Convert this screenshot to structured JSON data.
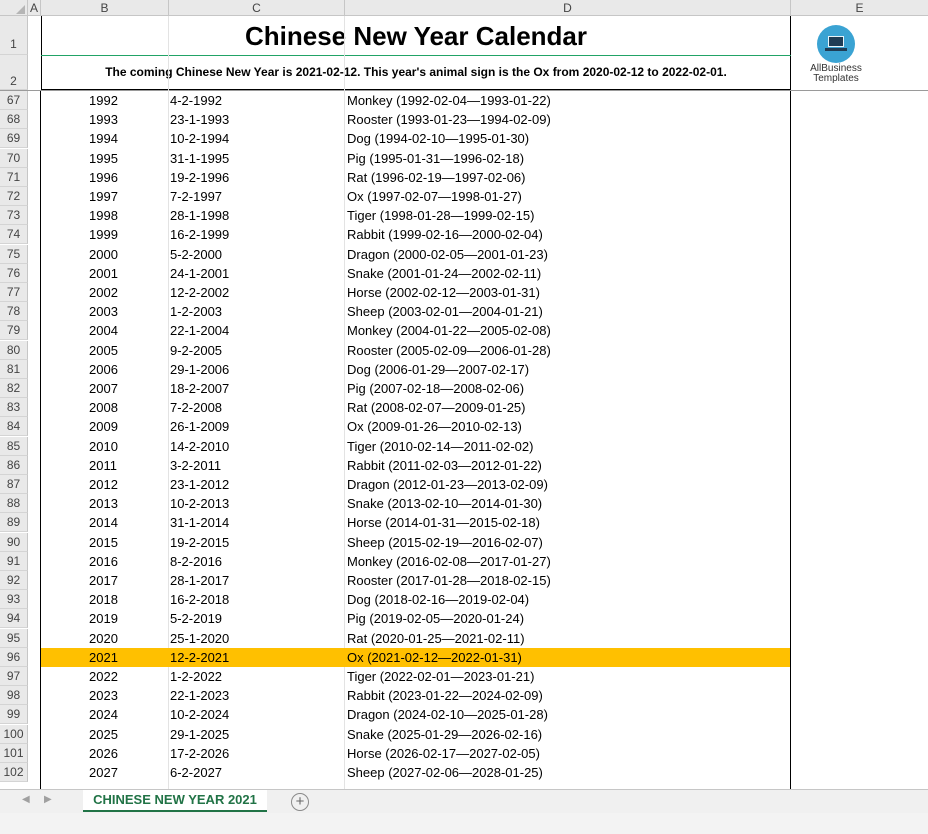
{
  "columns": [
    "A",
    "B",
    "C",
    "D",
    "E"
  ],
  "title": "Chinese New Year Calendar",
  "subtitle": "The coming Chinese New Year is 2021-02-12. This year's animal sign is the Ox from 2020-02-12 to 2022-02-01.",
  "logo": {
    "line1": "AllBusiness",
    "line2": "Templates",
    "icon": "laptop-icon",
    "color": "#3aa3d3"
  },
  "header_rows": [
    "1",
    "2"
  ],
  "highlight_color": "#ffc000",
  "rows": [
    {
      "row": "67",
      "year": "1992",
      "date": "4-2-1992",
      "animal": "Monkey (1992-02-04—1993-01-22)"
    },
    {
      "row": "68",
      "year": "1993",
      "date": "23-1-1993",
      "animal": "Rooster (1993-01-23—1994-02-09)"
    },
    {
      "row": "69",
      "year": "1994",
      "date": "10-2-1994",
      "animal": "Dog (1994-02-10—1995-01-30)"
    },
    {
      "row": "70",
      "year": "1995",
      "date": "31-1-1995",
      "animal": "Pig (1995-01-31—1996-02-18)"
    },
    {
      "row": "71",
      "year": "1996",
      "date": "19-2-1996",
      "animal": "Rat (1996-02-19—1997-02-06)"
    },
    {
      "row": "72",
      "year": "1997",
      "date": "7-2-1997",
      "animal": "Ox (1997-02-07—1998-01-27)"
    },
    {
      "row": "73",
      "year": "1998",
      "date": "28-1-1998",
      "animal": "Tiger (1998-01-28—1999-02-15)"
    },
    {
      "row": "74",
      "year": "1999",
      "date": "16-2-1999",
      "animal": "Rabbit (1999-02-16—2000-02-04)"
    },
    {
      "row": "75",
      "year": "2000",
      "date": "5-2-2000",
      "animal": "Dragon (2000-02-05—2001-01-23)"
    },
    {
      "row": "76",
      "year": "2001",
      "date": "24-1-2001",
      "animal": "Snake (2001-01-24—2002-02-11)"
    },
    {
      "row": "77",
      "year": "2002",
      "date": "12-2-2002",
      "animal": "Horse (2002-02-12—2003-01-31)"
    },
    {
      "row": "78",
      "year": "2003",
      "date": "1-2-2003",
      "animal": "Sheep (2003-02-01—2004-01-21)"
    },
    {
      "row": "79",
      "year": "2004",
      "date": "22-1-2004",
      "animal": "Monkey (2004-01-22—2005-02-08)"
    },
    {
      "row": "80",
      "year": "2005",
      "date": "9-2-2005",
      "animal": "Rooster (2005-02-09—2006-01-28)"
    },
    {
      "row": "81",
      "year": "2006",
      "date": "29-1-2006",
      "animal": "Dog (2006-01-29—2007-02-17)"
    },
    {
      "row": "82",
      "year": "2007",
      "date": "18-2-2007",
      "animal": "Pig (2007-02-18—2008-02-06)"
    },
    {
      "row": "83",
      "year": "2008",
      "date": "7-2-2008",
      "animal": "Rat (2008-02-07—2009-01-25)"
    },
    {
      "row": "84",
      "year": "2009",
      "date": "26-1-2009",
      "animal": "Ox (2009-01-26—2010-02-13)"
    },
    {
      "row": "85",
      "year": "2010",
      "date": "14-2-2010",
      "animal": "Tiger (2010-02-14—2011-02-02)"
    },
    {
      "row": "86",
      "year": "2011",
      "date": "3-2-2011",
      "animal": "Rabbit (2011-02-03—2012-01-22)"
    },
    {
      "row": "87",
      "year": "2012",
      "date": "23-1-2012",
      "animal": "Dragon (2012-01-23—2013-02-09)"
    },
    {
      "row": "88",
      "year": "2013",
      "date": "10-2-2013",
      "animal": "Snake (2013-02-10—2014-01-30)"
    },
    {
      "row": "89",
      "year": "2014",
      "date": "31-1-2014",
      "animal": "Horse (2014-01-31—2015-02-18)"
    },
    {
      "row": "90",
      "year": "2015",
      "date": "19-2-2015",
      "animal": "Sheep (2015-02-19—2016-02-07)"
    },
    {
      "row": "91",
      "year": "2016",
      "date": "8-2-2016",
      "animal": "Monkey (2016-02-08—2017-01-27)"
    },
    {
      "row": "92",
      "year": "2017",
      "date": "28-1-2017",
      "animal": "Rooster (2017-01-28—2018-02-15)"
    },
    {
      "row": "93",
      "year": "2018",
      "date": "16-2-2018",
      "animal": "Dog (2018-02-16—2019-02-04)"
    },
    {
      "row": "94",
      "year": "2019",
      "date": "5-2-2019",
      "animal": "Pig (2019-02-05—2020-01-24)"
    },
    {
      "row": "95",
      "year": "2020",
      "date": "25-1-2020",
      "animal": "Rat (2020-01-25—2021-02-11)"
    },
    {
      "row": "96",
      "year": "2021",
      "date": "12-2-2021",
      "animal": "Ox (2021-02-12—2022-01-31)",
      "highlight": true
    },
    {
      "row": "97",
      "year": "2022",
      "date": "1-2-2022",
      "animal": "Tiger (2022-02-01—2023-01-21)"
    },
    {
      "row": "98",
      "year": "2023",
      "date": "22-1-2023",
      "animal": "Rabbit (2023-01-22—2024-02-09)"
    },
    {
      "row": "99",
      "year": "2024",
      "date": "10-2-2024",
      "animal": "Dragon (2024-02-10—2025-01-28)"
    },
    {
      "row": "100",
      "year": "2025",
      "date": "29-1-2025",
      "animal": "Snake (2025-01-29—2026-02-16)"
    },
    {
      "row": "101",
      "year": "2026",
      "date": "17-2-2026",
      "animal": "Horse (2026-02-17—2027-02-05)"
    },
    {
      "row": "102",
      "year": "2027",
      "date": "6-2-2027",
      "animal": "Sheep (2027-02-06—2028-01-25)"
    }
  ],
  "sheet_tab": "CHINESE NEW YEAR 2021",
  "add_sheet_symbol": "+",
  "nav": {
    "prev": "◀",
    "next": "▶"
  }
}
